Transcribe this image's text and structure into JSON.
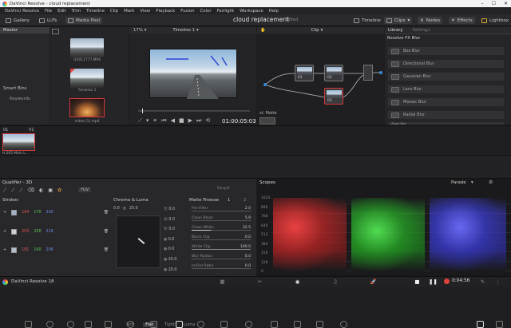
{
  "window": {
    "app_title": "DaVinci Resolve - cloud replacement",
    "min": "–",
    "max": "☐",
    "close": "✕"
  },
  "menu": [
    "DaVinci Resolve",
    "File",
    "Edit",
    "Trim",
    "Timeline",
    "Clip",
    "Mark",
    "View",
    "Playback",
    "Fusion",
    "Color",
    "Fairlight",
    "Workspace",
    "Help"
  ],
  "toolbar": {
    "gallery": "Gallery",
    "luts": "LUTs",
    "media_pool": "Media Pool",
    "project_name": "cloud replacement",
    "project_status": "Edited",
    "timeline": "Timeline",
    "clips": "Clips",
    "nodes": "Nodes",
    "effects": "Effects",
    "lightbox": "Lightbox"
  },
  "media_pool": {
    "bin": "Master",
    "smart_bins": "Smart Bins",
    "keywords": "Keywords",
    "clips": [
      {
        "name": "GX011777.MP4"
      },
      {
        "name": "Timeline 1"
      },
      {
        "name": "video (1).mp4"
      }
    ]
  },
  "viewer": {
    "zoom": "17%",
    "timeline_name": "Timeline 1",
    "timecode": "01:00:05:03"
  },
  "node_editor": {
    "mode": "Clip",
    "nodes": [
      "01",
      "02",
      "03"
    ],
    "matte_label": "xt. Matte"
  },
  "library": {
    "tab_library": "Library",
    "tab_settings": "Settings",
    "section": "Resolve FX Blur",
    "items": [
      "Box Blur",
      "Directional Blur",
      "Gaussian Blur",
      "Lens Blur",
      "Mosaic Blur",
      "Radial Blur",
      "Zoom Blur"
    ]
  },
  "clip_strip": {
    "index": "01",
    "track": "V1",
    "codec": "H.265 Main L..."
  },
  "qualifier": {
    "title": "Qualifier - 3D",
    "tabs": [
      "Soft",
      "Flat",
      "Tight",
      "Luma"
    ],
    "active_tab": "Flat",
    "color_space": "YUV",
    "strokes_label": "Strokes",
    "strokes": [
      {
        "r": "164",
        "g": "178",
        "b": "200"
      },
      {
        "r": "203",
        "g": "208",
        "b": "219"
      },
      {
        "r": "181",
        "g": "190",
        "b": "206"
      }
    ]
  },
  "chroma_luma": {
    "title": "Chroma & Luma",
    "value_a": "0.0",
    "value_b": "25.0",
    "y": "0.0",
    "u": "0.0",
    "v": "0.0",
    "r1": "0.0",
    "r2": "0.0",
    "r3": "20.0",
    "r4": "20.0"
  },
  "matte_finesse": {
    "title": "Matte Finesse",
    "page1": "1",
    "page2": "2",
    "despill": "Despill",
    "rows": [
      {
        "label": "Pre-Filter",
        "value": "2.0"
      },
      {
        "label": "Clean Black",
        "value": "5.9"
      },
      {
        "label": "Clean White",
        "value": "32.5"
      },
      {
        "label": "Black Clip",
        "value": "0.0"
      },
      {
        "label": "White Clip",
        "value": "100.0"
      },
      {
        "label": "Blur Radius",
        "value": "0.0"
      },
      {
        "label": "In/Out Ratio",
        "value": "0.0"
      }
    ]
  },
  "scopes": {
    "title": "Scopes",
    "mode": "Parade",
    "scale": [
      "1023",
      "896",
      "768",
      "640",
      "512",
      "384",
      "256",
      "128",
      "0"
    ]
  },
  "footer": {
    "app_name": "DaVinci Resolve 18",
    "timecode": "0:04:56"
  },
  "colors": {
    "accent": "#e0433a",
    "selected_border": "#d63a3a",
    "panel": "#28282b"
  }
}
